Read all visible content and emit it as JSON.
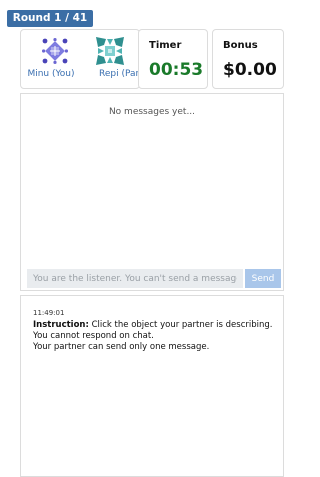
{
  "round": {
    "label": "Round 1 / 41"
  },
  "players": {
    "me": {
      "name": "Minu (You)",
      "icon": "purple-diamond-avatar-icon",
      "color": "#5b56c9"
    },
    "partner": {
      "name": "Repi (Partner",
      "icon": "teal-pinwheel-avatar-icon",
      "color": "#2f8f8f"
    }
  },
  "timer": {
    "label": "Timer",
    "value": "00:53",
    "color": "#1a7a2a"
  },
  "bonus": {
    "label": "Bonus",
    "value": "$0.00"
  },
  "chat": {
    "empty_text": "No messages yet...",
    "input_placeholder": "You are the listener. You can't send a message",
    "send_label": "Send"
  },
  "log": {
    "timestamp": "11:49:01",
    "instruction_label": "Instruction:",
    "instruction_text": " Click the object your partner is describing.",
    "line2": "You cannot respond on chat.",
    "line3": "Your partner can send only one message."
  }
}
